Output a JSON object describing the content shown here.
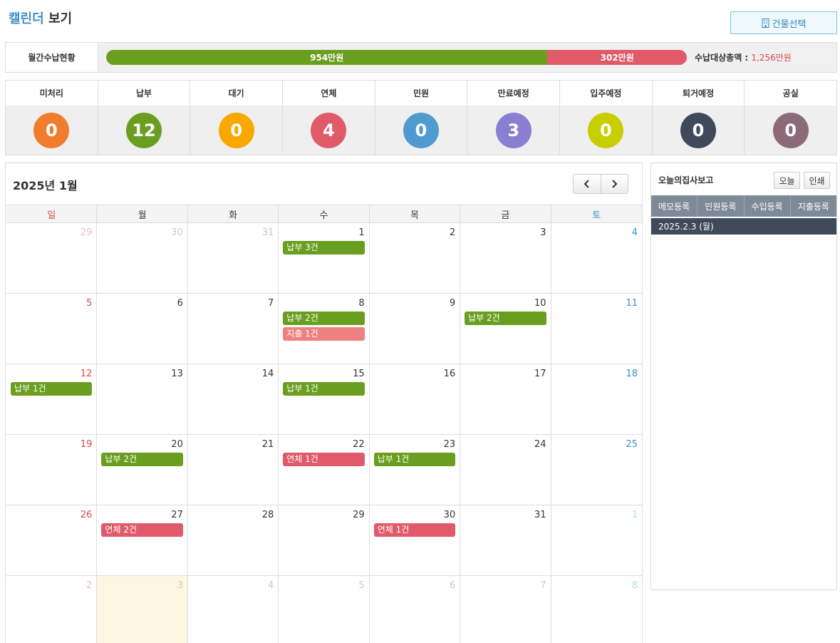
{
  "header": {
    "title_accent": "캘린더",
    "title_rest": "보기",
    "building_button": "건물선택"
  },
  "monthly": {
    "label": "월간수납현황",
    "paid_label": "954만원",
    "unpaid_label": "302만원",
    "paid_fraction": 0.76,
    "total_label": "수납대상총액 : ",
    "total_amount": "1,256만원"
  },
  "stats": [
    {
      "label": "미처리",
      "count": "0",
      "color": "#f07c2e"
    },
    {
      "label": "납부",
      "count": "12",
      "color": "#6a9e1f"
    },
    {
      "label": "대기",
      "count": "0",
      "color": "#f9a800"
    },
    {
      "label": "연체",
      "count": "4",
      "color": "#e05a6a"
    },
    {
      "label": "민원",
      "count": "0",
      "color": "#4f9bd0"
    },
    {
      "label": "만료예정",
      "count": "3",
      "color": "#8a7fd1"
    },
    {
      "label": "입주예정",
      "count": "0",
      "color": "#c8cd00"
    },
    {
      "label": "퇴거예정",
      "count": "0",
      "color": "#3e4a5a"
    },
    {
      "label": "공실",
      "count": "0",
      "color": "#8c6a78"
    }
  ],
  "calendar": {
    "month_title": "2025년 1월",
    "weekdays": [
      "일",
      "월",
      "화",
      "수",
      "목",
      "금",
      "토"
    ],
    "weeks": [
      [
        {
          "d": "29",
          "other": true
        },
        {
          "d": "30",
          "other": true
        },
        {
          "d": "31",
          "other": true
        },
        {
          "d": "1",
          "events": [
            {
              "t": "납부 3건",
              "c": "green"
            }
          ]
        },
        {
          "d": "2"
        },
        {
          "d": "3"
        },
        {
          "d": "4"
        }
      ],
      [
        {
          "d": "5"
        },
        {
          "d": "6"
        },
        {
          "d": "7"
        },
        {
          "d": "8",
          "events": [
            {
              "t": "납부 2건",
              "c": "green"
            },
            {
              "t": "지출 1건",
              "c": "pink"
            }
          ]
        },
        {
          "d": "9"
        },
        {
          "d": "10",
          "events": [
            {
              "t": "납부 2건",
              "c": "green"
            }
          ]
        },
        {
          "d": "11"
        }
      ],
      [
        {
          "d": "12",
          "events": [
            {
              "t": "납부 1건",
              "c": "green"
            }
          ]
        },
        {
          "d": "13"
        },
        {
          "d": "14"
        },
        {
          "d": "15",
          "events": [
            {
              "t": "납부 1건",
              "c": "green"
            }
          ]
        },
        {
          "d": "16"
        },
        {
          "d": "17"
        },
        {
          "d": "18"
        }
      ],
      [
        {
          "d": "19"
        },
        {
          "d": "20",
          "events": [
            {
              "t": "납부 2건",
              "c": "green"
            }
          ]
        },
        {
          "d": "21"
        },
        {
          "d": "22",
          "events": [
            {
              "t": "연체 1건",
              "c": "red"
            }
          ]
        },
        {
          "d": "23",
          "events": [
            {
              "t": "납부 1건",
              "c": "green"
            }
          ]
        },
        {
          "d": "24"
        },
        {
          "d": "25"
        }
      ],
      [
        {
          "d": "26"
        },
        {
          "d": "27",
          "events": [
            {
              "t": "연체 2건",
              "c": "red"
            }
          ]
        },
        {
          "d": "28"
        },
        {
          "d": "29"
        },
        {
          "d": "30",
          "events": [
            {
              "t": "연체 1건",
              "c": "red"
            }
          ]
        },
        {
          "d": "31"
        },
        {
          "d": "1",
          "other": true
        }
      ],
      [
        {
          "d": "2",
          "other": true
        },
        {
          "d": "3",
          "other": true,
          "today": true
        },
        {
          "d": "4",
          "other": true
        },
        {
          "d": "5",
          "other": true
        },
        {
          "d": "6",
          "other": true
        },
        {
          "d": "7",
          "other": true
        },
        {
          "d": "8",
          "other": true
        }
      ]
    ]
  },
  "side": {
    "title": "오늘의집사보고",
    "today_button": "오늘",
    "print_button": "인쇄",
    "tabs": [
      "메모등록",
      "민원등록",
      "수입등록",
      "지출등록"
    ],
    "date": "2025.2.3 (월)"
  }
}
